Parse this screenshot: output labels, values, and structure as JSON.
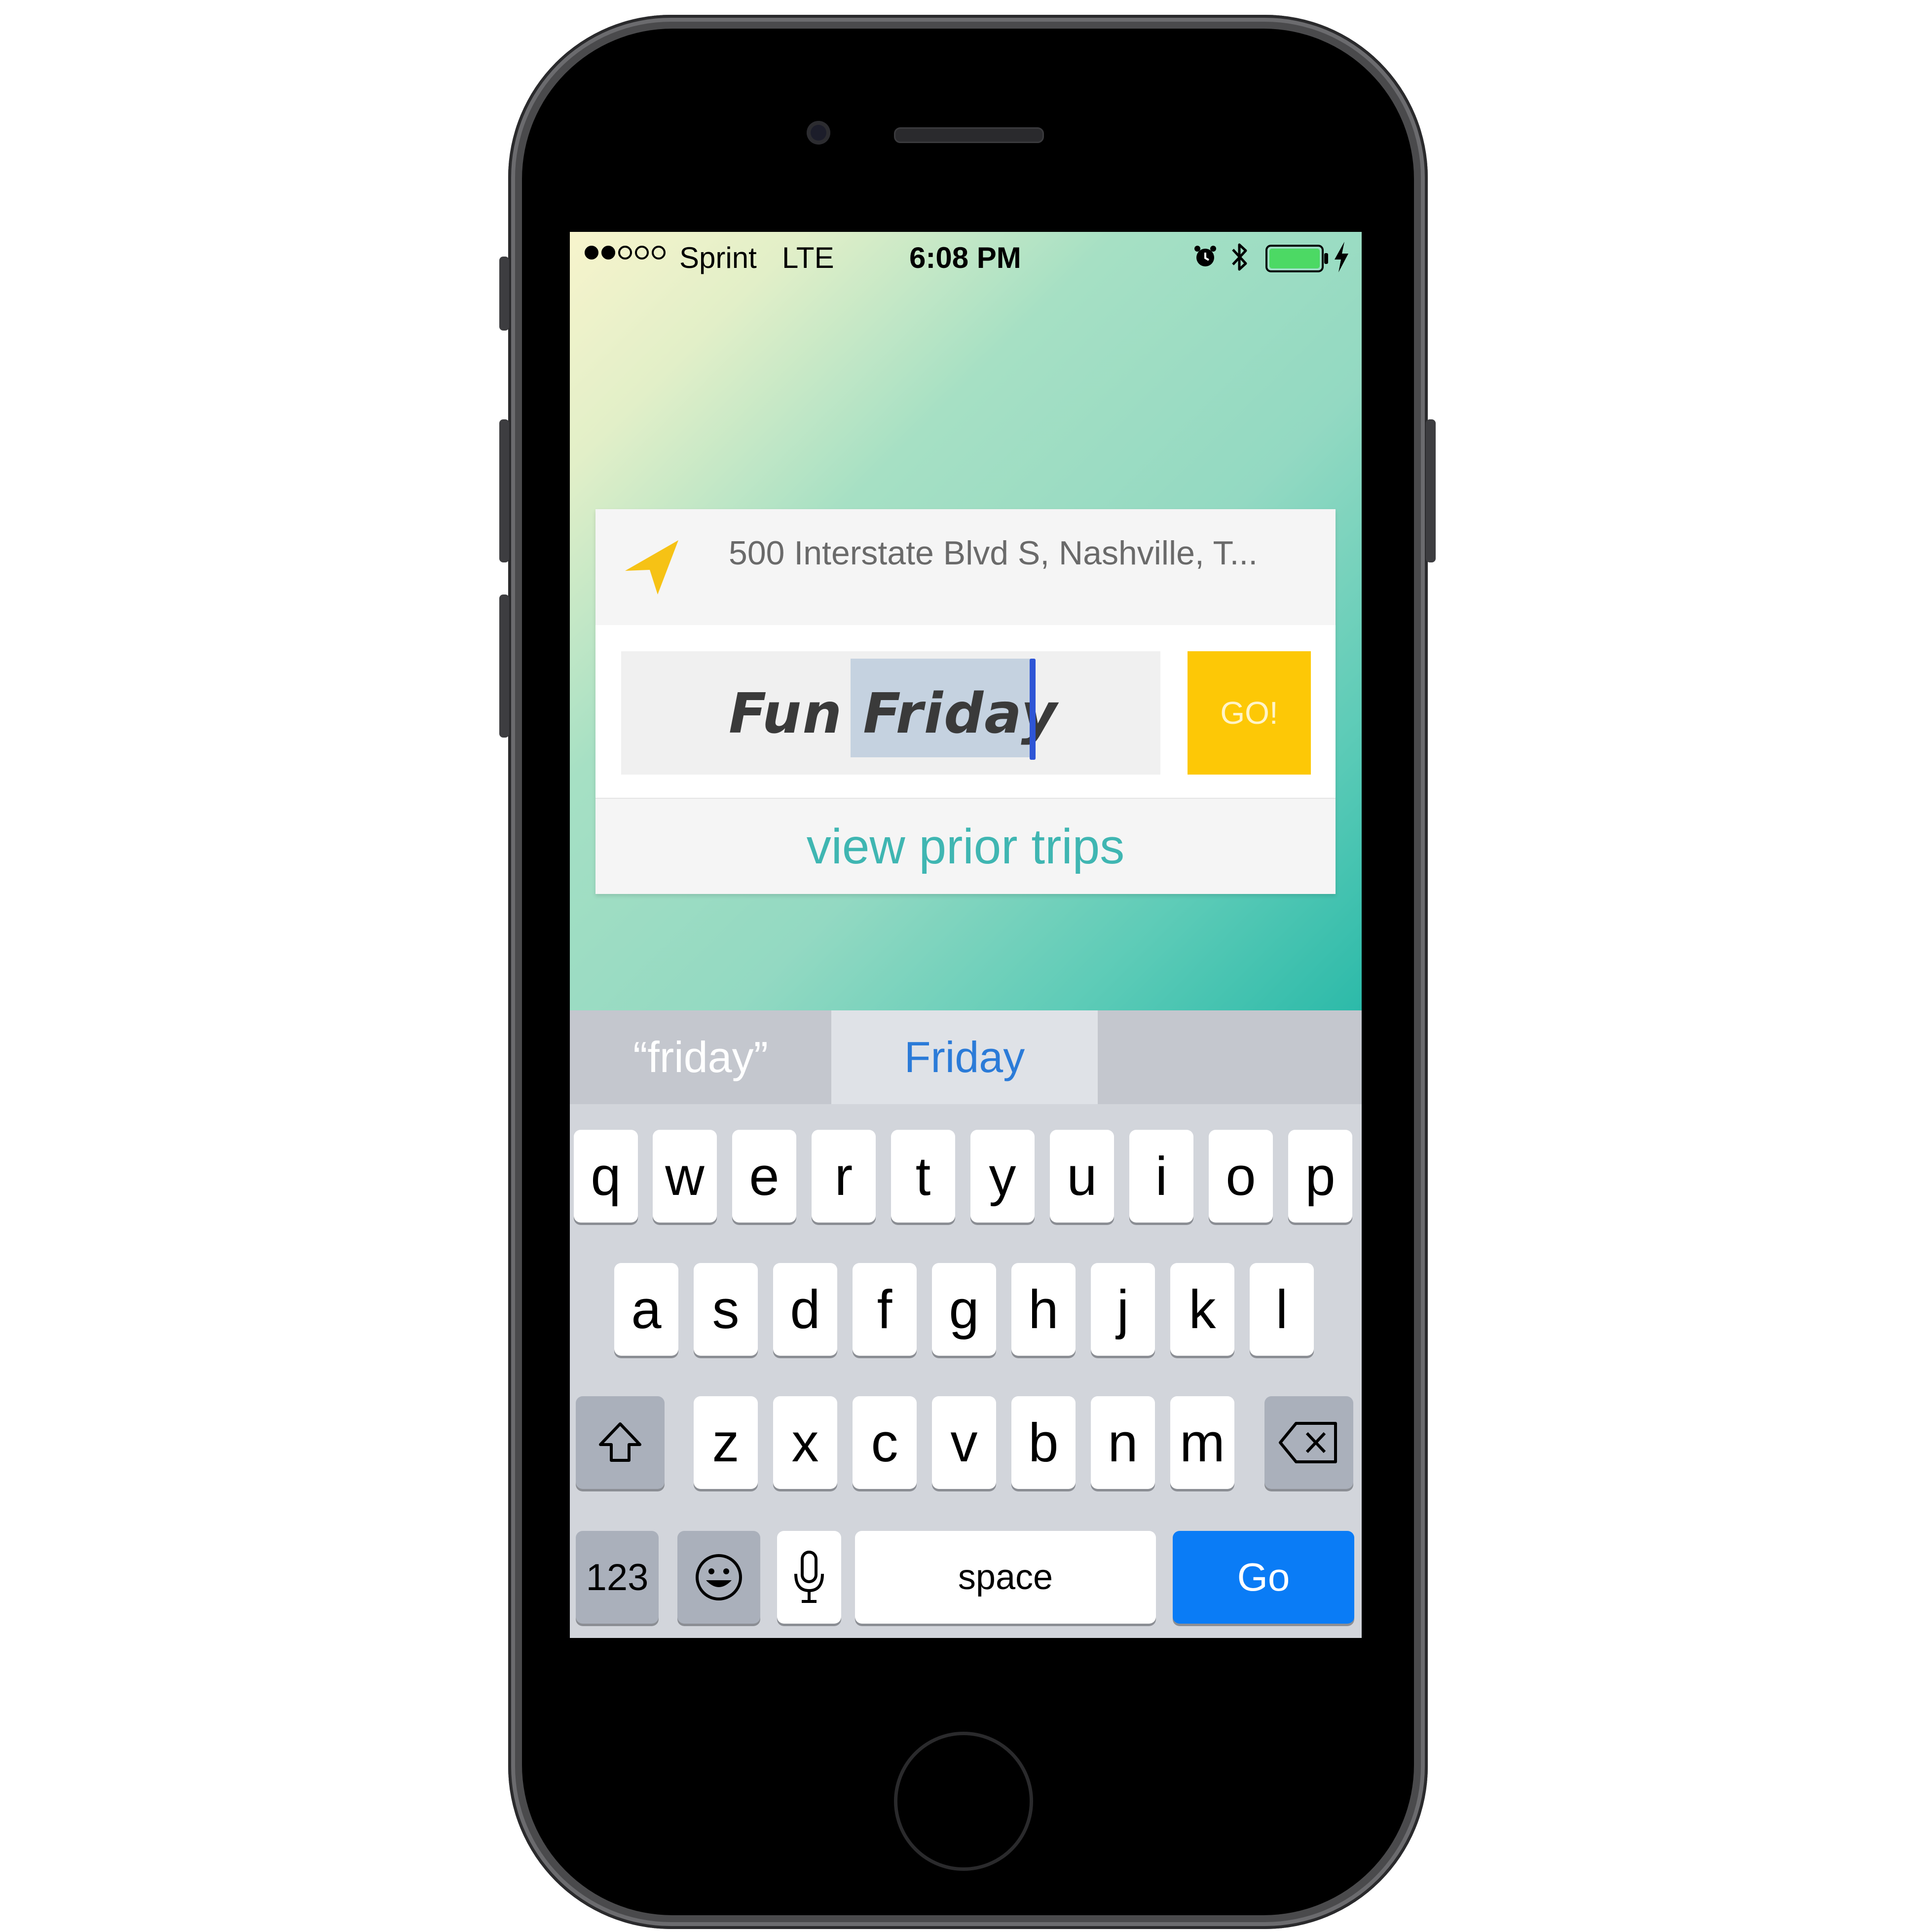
{
  "status_bar": {
    "carrier": "Sprint",
    "network": "LTE",
    "time": "6:08 PM",
    "signal_strength": 2,
    "signal_max": 5,
    "battery_level": 1.0,
    "battery_color": "#4cd964"
  },
  "app": {
    "address": "500 Interstate Blvd S, Nashville, T...",
    "trip_name_prefix": "Fun ",
    "trip_name_selected": "Friday",
    "go_label": "GO!",
    "prior_trips_label": "view prior trips",
    "accent_color": "#fdc806",
    "link_color": "#3fb6b2",
    "icons": {
      "location": "navigation-arrow-icon"
    }
  },
  "keyboard": {
    "suggestions": [
      "“friday”",
      "Friday"
    ],
    "row1": [
      "q",
      "w",
      "e",
      "r",
      "t",
      "y",
      "u",
      "i",
      "o",
      "p"
    ],
    "row2": [
      "a",
      "s",
      "d",
      "f",
      "g",
      "h",
      "j",
      "k",
      "l"
    ],
    "row3": [
      "z",
      "x",
      "c",
      "v",
      "b",
      "n",
      "m"
    ],
    "bottom": {
      "numbers_label": "123",
      "space_label": "space",
      "go_label": "Go"
    },
    "icons": {
      "shift": "shift-icon",
      "delete": "delete-icon",
      "emoji": "emoji-icon",
      "mic": "microphone-icon"
    },
    "go_color": "#0a7cf6"
  }
}
